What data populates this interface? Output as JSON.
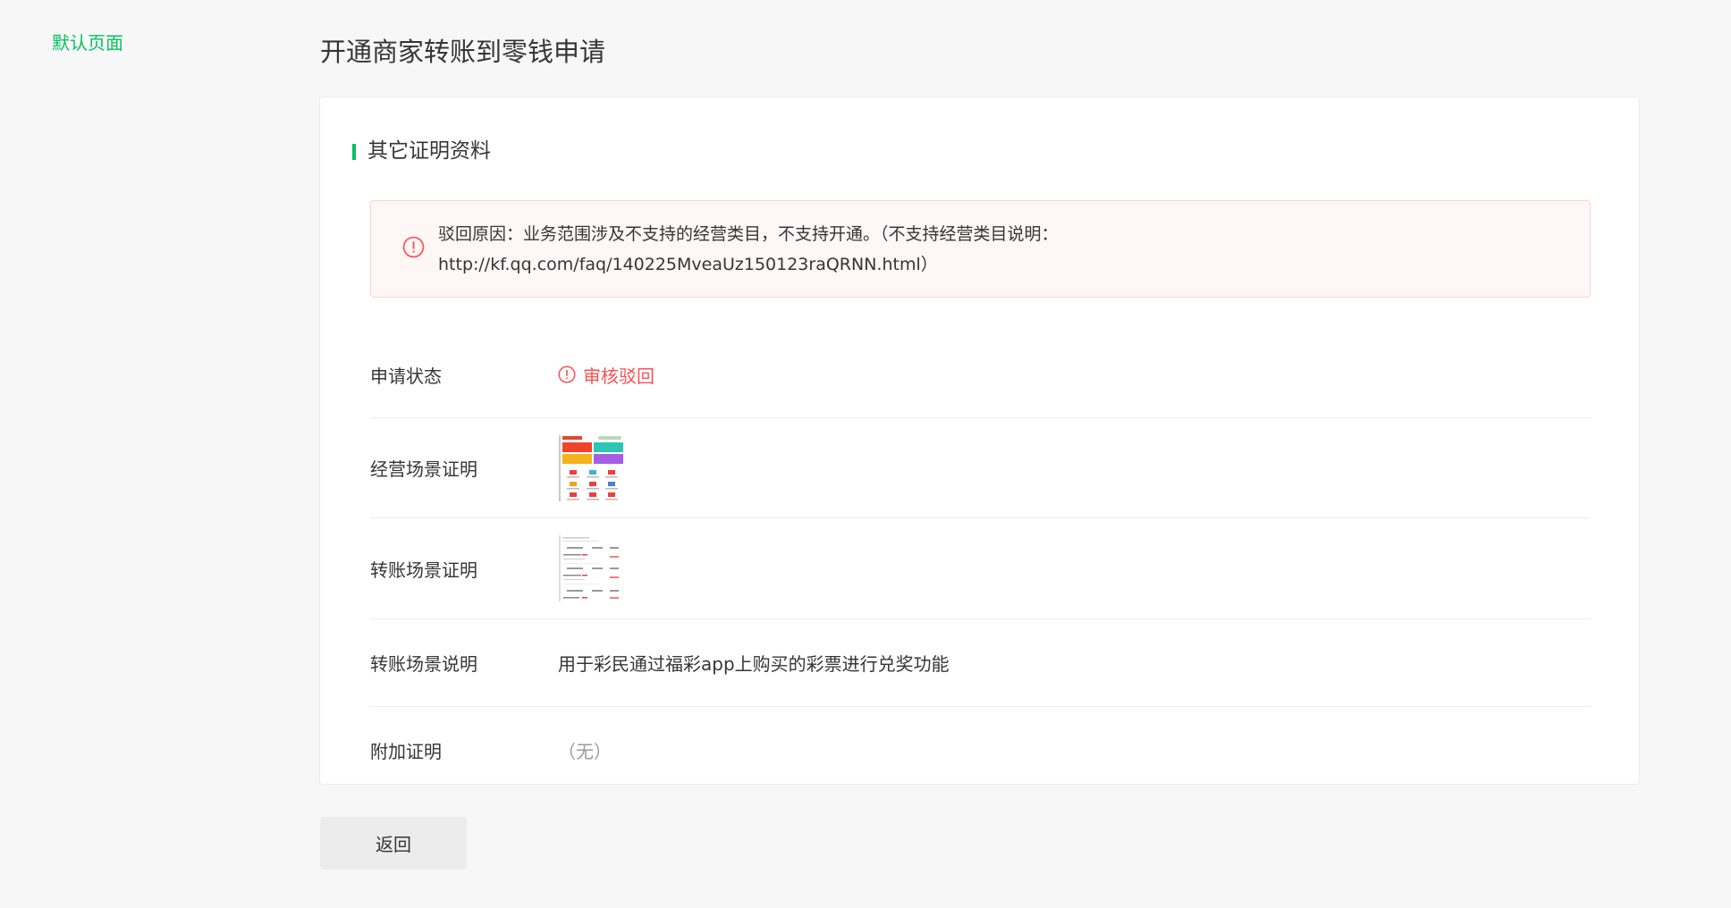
{
  "sidebar": {
    "default_page_label": "默认页面"
  },
  "page": {
    "title": "开通商家转账到零钱申请"
  },
  "section": {
    "title": "其它证明资料"
  },
  "alert": {
    "line1": "驳回原因：业务范围涉及不支持的经营类目，不支持开通。（不支持经营类目说明：",
    "line2": "http://kf.qq.com/faq/140225MveaUz150123raQRNN.html）",
    "color": "#fa5151"
  },
  "rows": {
    "status": {
      "label": "申请状态",
      "value": "审核驳回"
    },
    "business_proof": {
      "label": "经营场景证明"
    },
    "transfer_proof": {
      "label": "转账场景证明"
    },
    "transfer_desc": {
      "label": "转账场景说明",
      "value": "用于彩民通过福彩app上购买的彩票进行兑奖功能"
    },
    "extra": {
      "label": "附加证明",
      "value": "（无）"
    }
  },
  "footer": {
    "back_label": "返回"
  },
  "colors": {
    "brand": "#07c160",
    "error": "#fa5151"
  }
}
